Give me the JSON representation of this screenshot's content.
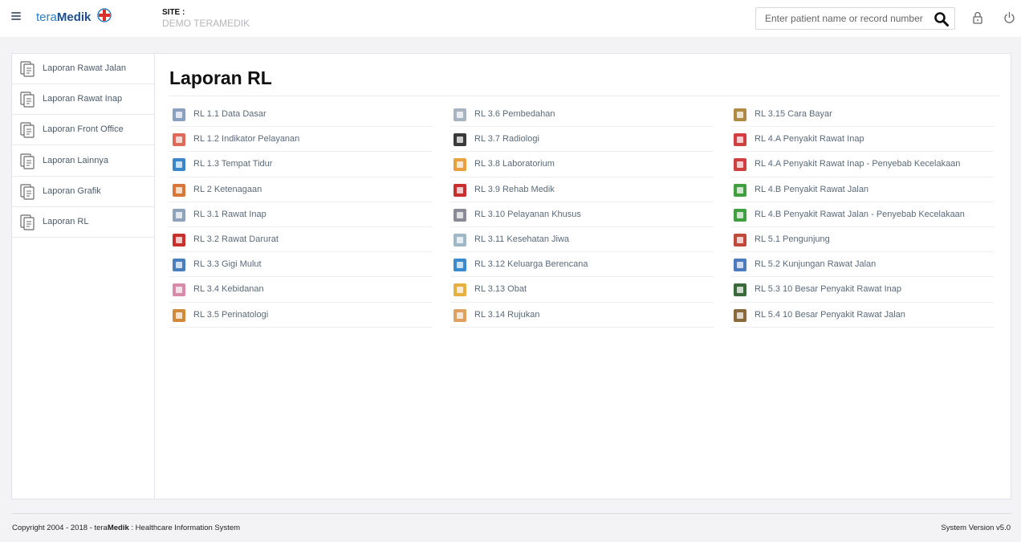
{
  "header": {
    "logo_tera": "tera",
    "logo_medik": "Medik",
    "site_label": "SITE :",
    "site_value": "DEMO TERAMEDIK",
    "search_placeholder": "Enter patient name or record number"
  },
  "sidebar": {
    "items": [
      {
        "label": "Laporan Rawat Jalan",
        "icon": "document-icon"
      },
      {
        "label": "Laporan Rawat Inap",
        "icon": "document-icon"
      },
      {
        "label": "Laporan Front Office",
        "icon": "document-icon"
      },
      {
        "label": "Laporan Lainnya",
        "icon": "document-icon"
      },
      {
        "label": "Laporan Grafik",
        "icon": "document-icon"
      },
      {
        "label": "Laporan RL",
        "icon": "document-icon"
      }
    ]
  },
  "main": {
    "title": "Laporan RL",
    "columns": [
      [
        {
          "label": "RL 1.1 Data Dasar",
          "icon": "building-icon",
          "color": "#8aa0c0"
        },
        {
          "label": "RL 1.2 Indikator Pelayanan",
          "icon": "chart-icon",
          "color": "#e06a5a"
        },
        {
          "label": "RL 1.3 Tempat Tidur",
          "icon": "bed-icon",
          "color": "#3a86c8"
        },
        {
          "label": "RL 2 Ketenagaan",
          "icon": "staff-icon",
          "color": "#d9773a"
        },
        {
          "label": "RL 3.1 Rawat Inap",
          "icon": "bed-icon",
          "color": "#8fa3bb"
        },
        {
          "label": "RL 3.2 Rawat Darurat",
          "icon": "emergency-icon",
          "color": "#c9302c"
        },
        {
          "label": "RL 3.3 Gigi Mulut",
          "icon": "dental-icon",
          "color": "#4a7fbf"
        },
        {
          "label": "RL 3.4 Kebidanan",
          "icon": "maternity-icon",
          "color": "#d88aa8"
        },
        {
          "label": "RL 3.5 Perinatologi",
          "icon": "baby-icon",
          "color": "#d08a3a"
        }
      ],
      [
        {
          "label": "RL 3.6 Pembedahan",
          "icon": "scalpel-icon",
          "color": "#a9b4c2"
        },
        {
          "label": "RL 3.7 Radiologi",
          "icon": "xray-icon",
          "color": "#3a3a3a"
        },
        {
          "label": "RL 3.8 Laboratorium",
          "icon": "flask-icon",
          "color": "#e8a040"
        },
        {
          "label": "RL 3.9 Rehab Medik",
          "icon": "medkit-icon",
          "color": "#c9302c"
        },
        {
          "label": "RL 3.10 Pelayanan Khusus",
          "icon": "service-icon",
          "color": "#8a8a96"
        },
        {
          "label": "RL 3.11 Kesehatan Jiwa",
          "icon": "mind-icon",
          "color": "#9fb8c8"
        },
        {
          "label": "RL 3.12 Keluarga Berencana",
          "icon": "family-icon",
          "color": "#3a8ad0"
        },
        {
          "label": "RL 3.13 Obat",
          "icon": "pill-icon",
          "color": "#e8b040"
        },
        {
          "label": "RL 3.14 Rujukan",
          "icon": "referral-icon",
          "color": "#e0a060"
        }
      ],
      [
        {
          "label": "RL 3.15 Cara Bayar",
          "icon": "payment-icon",
          "color": "#b08a40"
        },
        {
          "label": "RL 4.A Penyakit Rawat Inap",
          "icon": "disease-icon",
          "color": "#d04040"
        },
        {
          "label": "RL 4.A Penyakit Rawat Inap - Penyebab Kecelakaan",
          "icon": "disease-icon",
          "color": "#d04040"
        },
        {
          "label": "RL 4.B Penyakit Rawat Jalan",
          "icon": "disease-icon",
          "color": "#40a040"
        },
        {
          "label": "RL 4.B Penyakit Rawat Jalan - Penyebab Kecelakaan",
          "icon": "disease-icon",
          "color": "#40a040"
        },
        {
          "label": "RL 5.1 Pengunjung",
          "icon": "visitors-icon",
          "color": "#c04a3a"
        },
        {
          "label": "RL 5.2 Kunjungan Rawat Jalan",
          "icon": "walking-icon",
          "color": "#4a7ac0"
        },
        {
          "label": "RL 5.3 10 Besar Penyakit Rawat Inap",
          "icon": "ranking-icon",
          "color": "#3a6a3a"
        },
        {
          "label": "RL 5.4 10 Besar Penyakit Rawat Jalan",
          "icon": "ranking-icon",
          "color": "#8a6a3a"
        }
      ]
    ]
  },
  "footer": {
    "copyright_prefix": "Copyright 2004 - 2018 - tera",
    "copyright_brand": "Medik",
    "copyright_suffix": " : Healthcare Information System",
    "version": "System Version v5.0"
  }
}
